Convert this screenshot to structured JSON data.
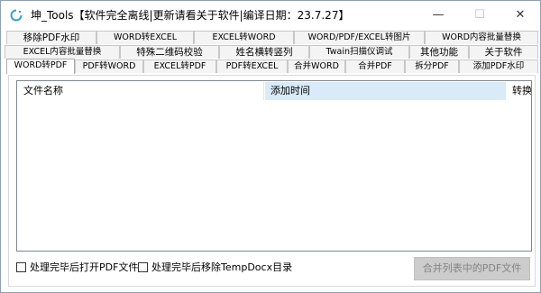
{
  "window": {
    "title": "坤_Tools【软件完全离线|更新请看关于软件|编译日期：23.7.27】",
    "controls": {
      "minimize": "—",
      "maximize": "☐",
      "close": "✕"
    }
  },
  "tabs": {
    "row1": [
      "移除PDF水印",
      "WORD转EXCEL",
      "EXCEL转WORD",
      "WORD/PDF/EXCEL转图片",
      "WORD内容批量替换"
    ],
    "row2": [
      "EXCEL内容批量替换",
      "特殊二维码校验",
      "姓名横转竖列",
      "Twain扫描仪调试",
      "其他功能",
      "关于软件"
    ],
    "row3": [
      "WORD转PDF",
      "PDF转WORD",
      "EXCEL转PDF",
      "PDF转EXCEL",
      "合并WORD",
      "合并PDF",
      "拆分PDF",
      "添加PDF水印"
    ],
    "active": "WORD转PDF"
  },
  "list": {
    "columns": [
      "文件名称",
      "添加时间",
      "转换后"
    ]
  },
  "options": {
    "open_pdf": "处理完毕后打开PDF文件",
    "remove_temp": "处理完毕后移除TempDocx目录"
  },
  "buttons": {
    "merge": "合并列表中的PDF文件"
  },
  "colors": {
    "selected_column": "#d9ebf9",
    "disabled_button": "#cccccc",
    "icon_accent": "#3aa0c8"
  }
}
